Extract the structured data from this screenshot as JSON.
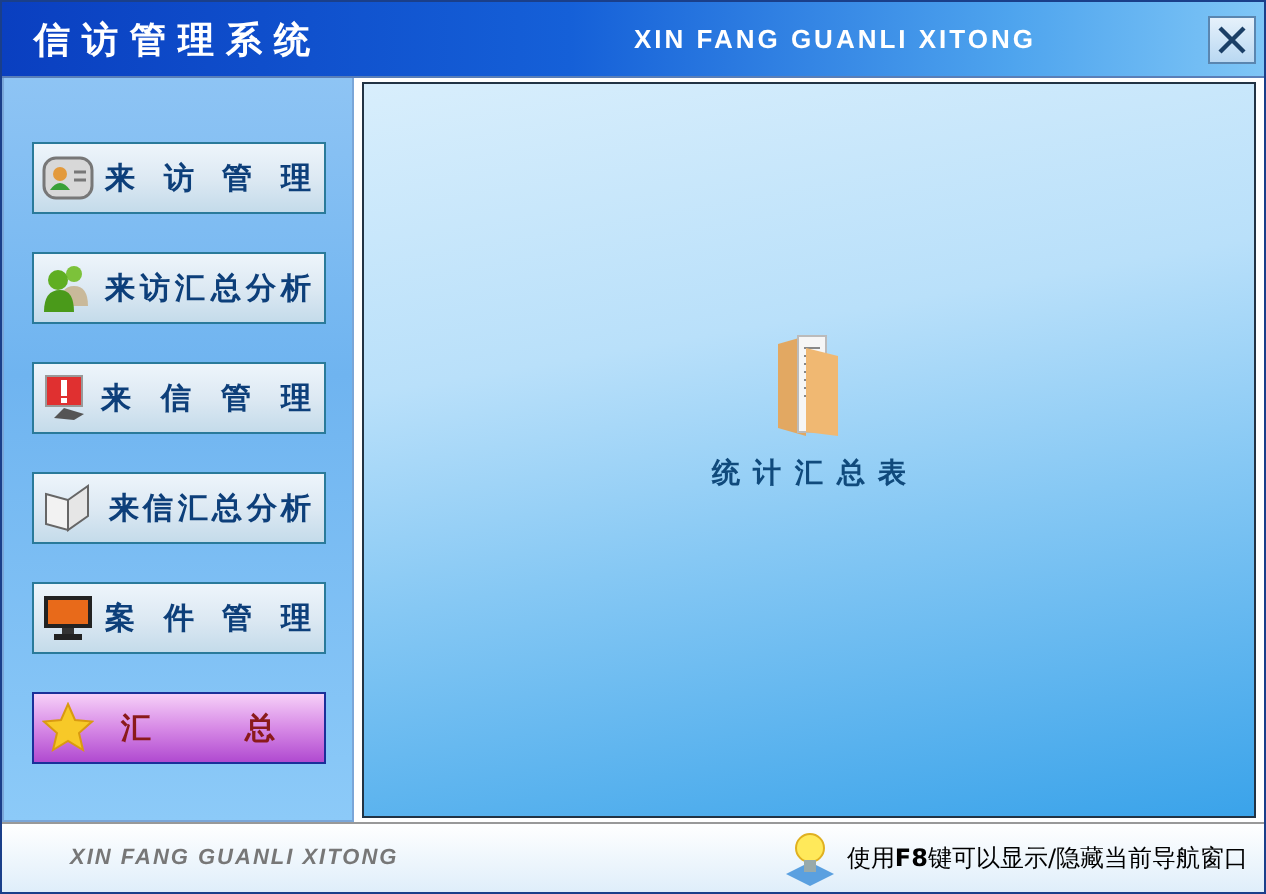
{
  "window": {
    "title": "信访管理系统",
    "subtitle": "XIN FANG GUANLI XITONG"
  },
  "sidebar": {
    "items": [
      {
        "label": "来 访 管 理",
        "selected": false
      },
      {
        "label": "来访汇总分析",
        "selected": false
      },
      {
        "label": "来 信 管 理",
        "selected": false
      },
      {
        "label": "来信汇总分析",
        "selected": false
      },
      {
        "label": "案 件 管 理",
        "selected": false
      },
      {
        "label": "汇 总",
        "selected": true
      }
    ]
  },
  "main": {
    "item_label": "统 计 汇 总 表"
  },
  "status_bar": {
    "brand": "XIN FANG GUANLI XITONG",
    "hint": "使用**F8**键可以显示/隐藏当前导航窗口"
  }
}
